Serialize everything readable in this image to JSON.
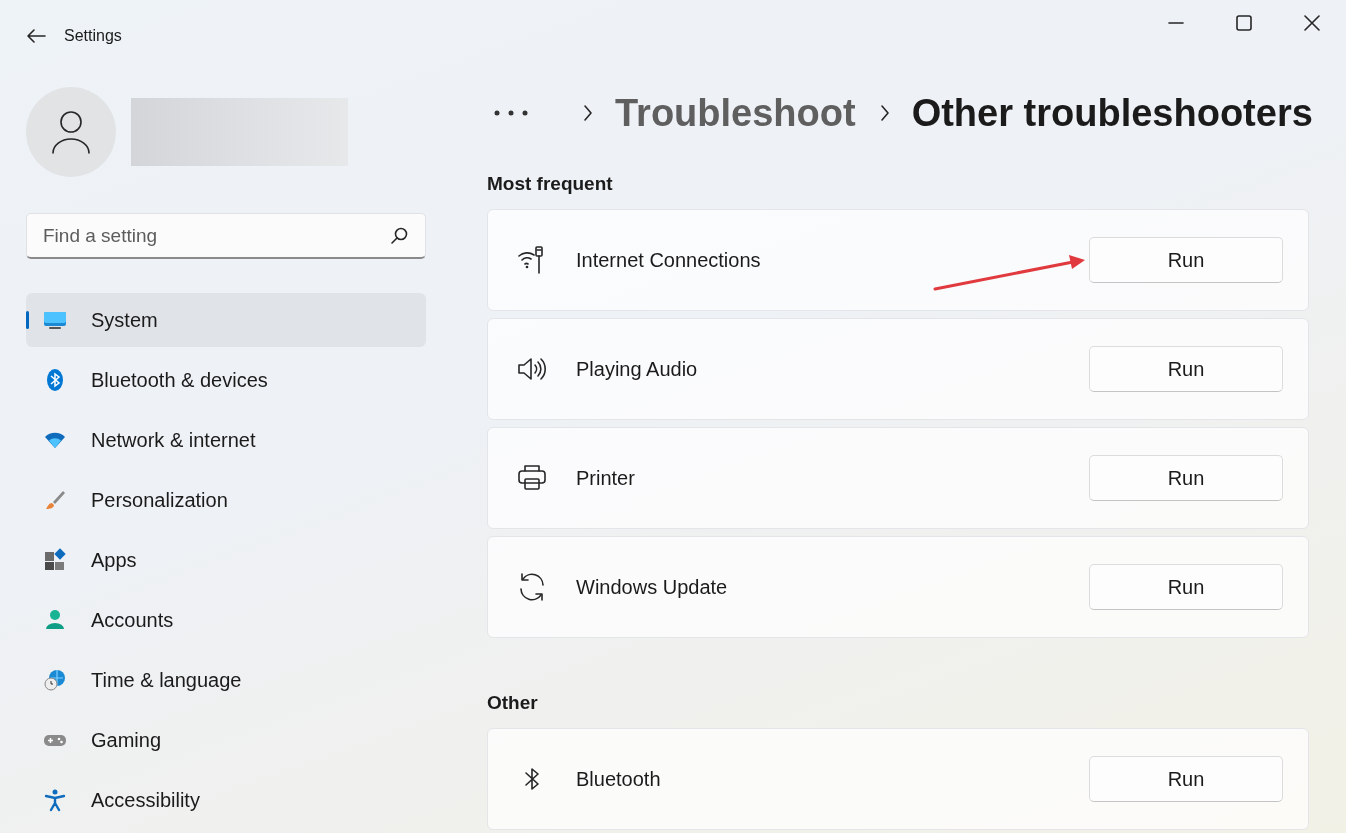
{
  "window": {
    "title": "Settings"
  },
  "profile": {
    "name_hidden": true
  },
  "search": {
    "placeholder": "Find a setting"
  },
  "sidebar": {
    "items": [
      {
        "kind": "system",
        "label": "System",
        "selected": true
      },
      {
        "kind": "bluetooth",
        "label": "Bluetooth & devices",
        "selected": false
      },
      {
        "kind": "network",
        "label": "Network & internet",
        "selected": false
      },
      {
        "kind": "personalization",
        "label": "Personalization",
        "selected": false
      },
      {
        "kind": "apps",
        "label": "Apps",
        "selected": false
      },
      {
        "kind": "accounts",
        "label": "Accounts",
        "selected": false
      },
      {
        "kind": "time",
        "label": "Time & language",
        "selected": false
      },
      {
        "kind": "gaming",
        "label": "Gaming",
        "selected": false
      },
      {
        "kind": "accessibility",
        "label": "Accessibility",
        "selected": false
      }
    ]
  },
  "breadcrumb": [
    {
      "label": "Troubleshoot",
      "current": false
    },
    {
      "label": "Other troubleshooters",
      "current": true
    }
  ],
  "sections": [
    {
      "title": "Most frequent",
      "items": [
        {
          "kind": "internet",
          "label": "Internet Connections",
          "button": "Run",
          "annotated": true
        },
        {
          "kind": "audio",
          "label": "Playing Audio",
          "button": "Run",
          "annotated": false
        },
        {
          "kind": "printer",
          "label": "Printer",
          "button": "Run",
          "annotated": false
        },
        {
          "kind": "update",
          "label": "Windows Update",
          "button": "Run",
          "annotated": false
        }
      ]
    },
    {
      "title": "Other",
      "items": [
        {
          "kind": "bluetooth",
          "label": "Bluetooth",
          "button": "Run",
          "annotated": false
        }
      ]
    }
  ]
}
